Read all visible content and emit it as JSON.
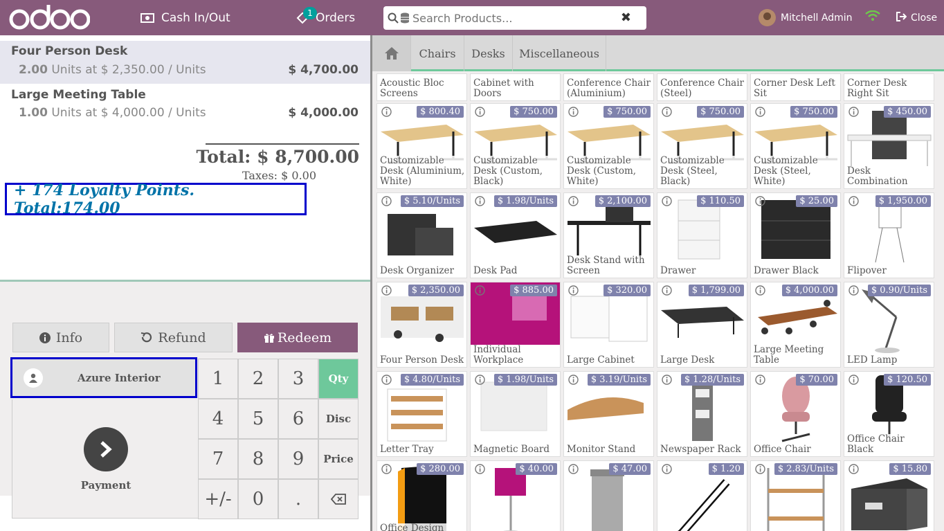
{
  "header": {
    "logo_text": "odoo",
    "cash_label": "Cash In/Out",
    "orders_label": "Orders",
    "orders_badge": "1",
    "search_placeholder": "Search Products...",
    "user_name": "Mitchell Admin",
    "close_label": "Close"
  },
  "order": {
    "lines": [
      {
        "name": "Four Person Desk",
        "qty": "2.00",
        "unit_text": "Units at $ 2,350.00 / Units",
        "price": "$ 4,700.00"
      },
      {
        "name": "Large Meeting Table",
        "qty": "1.00",
        "unit_text": "Units at $ 4,000.00 / Units",
        "price": "$ 4,000.00"
      }
    ],
    "total": "Total: $ 8,700.00",
    "taxes": "Taxes: $ 0.00",
    "loyalty": "+ 174 Loyalty Points. Total:174.00"
  },
  "controls": {
    "info": "Info",
    "refund": "Refund",
    "redeem": "Redeem",
    "customer": "Azure Interior",
    "payment": "Payment"
  },
  "numpad": {
    "keys": [
      "1",
      "2",
      "3",
      "4",
      "5",
      "6",
      "7",
      "8",
      "9",
      "+/-",
      "0",
      "."
    ],
    "modes": [
      "Qty",
      "Disc",
      "Price"
    ]
  },
  "categories": [
    "Chairs",
    "Desks",
    "Miscellaneous"
  ],
  "products_top": [
    {
      "name": "Acoustic Bloc Screens"
    },
    {
      "name": "Cabinet with Doors"
    },
    {
      "name": "Conference Chair (Aluminium)"
    },
    {
      "name": "Conference Chair (Steel)"
    },
    {
      "name": "Corner Desk Left Sit"
    },
    {
      "name": "Corner Desk Right Sit"
    }
  ],
  "products": [
    {
      "name": "Customizable Desk (Aluminium, White)",
      "price": "$ 800.40"
    },
    {
      "name": "Customizable Desk (Custom, Black)",
      "price": "$ 750.00"
    },
    {
      "name": "Customizable Desk (Custom, White)",
      "price": "$ 750.00"
    },
    {
      "name": "Customizable Desk (Steel, Black)",
      "price": "$ 750.00"
    },
    {
      "name": "Customizable Desk (Steel, White)",
      "price": "$ 750.00"
    },
    {
      "name": "Desk Combination",
      "price": "$ 450.00"
    },
    {
      "name": "Desk Organizer",
      "price": "$ 5.10/Units"
    },
    {
      "name": "Desk Pad",
      "price": "$ 1.98/Units"
    },
    {
      "name": "Desk Stand with Screen",
      "price": "$ 2,100.00"
    },
    {
      "name": "Drawer",
      "price": "$ 110.50"
    },
    {
      "name": "Drawer Black",
      "price": "$ 25.00"
    },
    {
      "name": "Flipover",
      "price": "$ 1,950.00"
    },
    {
      "name": "Four Person Desk",
      "price": "$ 2,350.00"
    },
    {
      "name": "Individual Workplace",
      "price": "$ 885.00"
    },
    {
      "name": "Large Cabinet",
      "price": "$ 320.00"
    },
    {
      "name": "Large Desk",
      "price": "$ 1,799.00"
    },
    {
      "name": "Large Meeting Table",
      "price": "$ 4,000.00"
    },
    {
      "name": "LED Lamp",
      "price": "$ 0.90/Units"
    },
    {
      "name": "Letter Tray",
      "price": "$ 4.80/Units"
    },
    {
      "name": "Magnetic Board",
      "price": "$ 1.98/Units"
    },
    {
      "name": "Monitor Stand",
      "price": "$ 3.19/Units"
    },
    {
      "name": "Newspaper Rack",
      "price": "$ 1.28/Units"
    },
    {
      "name": "Office Chair",
      "price": "$ 70.00"
    },
    {
      "name": "Office Chair Black",
      "price": "$ 120.50"
    },
    {
      "name": "Office Design Software",
      "price": "$ 280.00"
    },
    {
      "name": "",
      "price": "$ 40.00"
    },
    {
      "name": "",
      "price": "$ 47.00"
    },
    {
      "name": "",
      "price": "$ 1.20"
    },
    {
      "name": "",
      "price": "$ 2.83/Units"
    },
    {
      "name": "",
      "price": "$ 15.80"
    }
  ],
  "colors": {
    "brand": "#875a7b",
    "accent": "#6ec89b",
    "price_badge": "#7f82ac",
    "highlight": "#0000cc"
  }
}
